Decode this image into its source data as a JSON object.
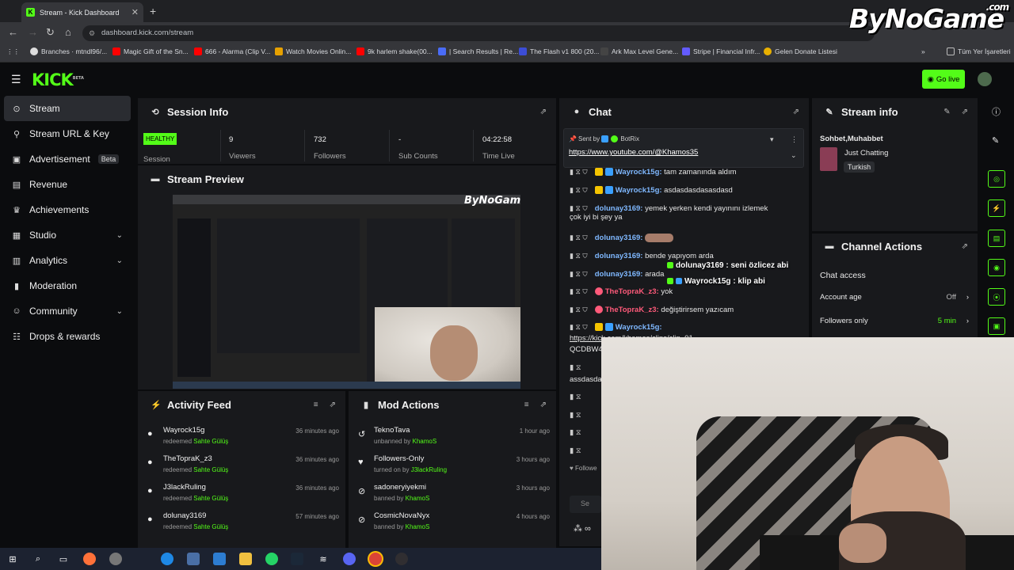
{
  "browser": {
    "tab_title": "Stream - Kick Dashboard",
    "tab_favicon": "K",
    "url": "dashboard.kick.com/stream",
    "bookmarks": [
      "Branches · mtndl96/...",
      "Magic Gift of the Sn...",
      "666 - Alarma (Clip V...",
      "Watch Movies Onlin...",
      "9k harlem shake(00...",
      "| Search Results | Re...",
      "The Flash v1 800 (20...",
      "Ark Max Level Gene...",
      "Stripe | Financial Infr...",
      "Gelen Donate Listesi"
    ],
    "all_bookmarks": "Tüm Yer İşaretleri"
  },
  "watermark": {
    "text": "ByNoGame",
    "suffix": ".com"
  },
  "header": {
    "logo": "KICK",
    "logo_sup": "BETA",
    "go_live": "Go live"
  },
  "sidebar": {
    "items": [
      {
        "label": "Stream",
        "icon": "broadcast-icon",
        "glyph": "((·))"
      },
      {
        "label": "Stream URL & Key",
        "icon": "link-icon",
        "glyph": "⚿"
      },
      {
        "label": "Advertisement",
        "icon": "ad-icon",
        "glyph": "▣",
        "badge": "Beta"
      },
      {
        "label": "Revenue",
        "icon": "revenue-icon",
        "glyph": "▤"
      },
      {
        "label": "Achievements",
        "icon": "trophy-icon",
        "glyph": "🏆"
      },
      {
        "label": "Studio",
        "icon": "studio-icon",
        "glyph": "▦"
      },
      {
        "label": "Analytics",
        "icon": "analytics-icon",
        "glyph": "▥"
      },
      {
        "label": "Moderation",
        "icon": "moderation-icon",
        "glyph": "⚑"
      },
      {
        "label": "Community",
        "icon": "community-icon",
        "glyph": "☺"
      },
      {
        "label": "Drops & rewards",
        "icon": "drops-icon",
        "glyph": "☷"
      }
    ]
  },
  "session": {
    "title": "Session Info",
    "status": "HEALTHY",
    "status_label": "Session",
    "viewers": "9",
    "viewers_label": "Viewers",
    "followers": "732",
    "followers_label": "Followers",
    "subs": "-",
    "subs_label": "Sub Counts",
    "time": "04:22:58",
    "time_label": "Time Live"
  },
  "preview": {
    "title": "Stream Preview",
    "wm": "ByNoGame"
  },
  "activity": {
    "title": "Activity Feed",
    "items": [
      {
        "user": "Wayrock15g",
        "action": "redeemed",
        "target": "Sahte Gülüş",
        "time": "36 minutes ago"
      },
      {
        "user": "TheTopraK_z3",
        "action": "redeemed",
        "target": "Sahte Gülüş",
        "time": "36 minutes ago"
      },
      {
        "user": "J3lackRuling",
        "action": "redeemed",
        "target": "Sahte Gülüş",
        "time": "36 minutes ago"
      },
      {
        "user": "dolunay3169",
        "action": "redeemed",
        "target": "Sahte Gülüş",
        "time": "57 minutes ago"
      }
    ]
  },
  "mod": {
    "title": "Mod Actions",
    "items": [
      {
        "user": "TeknoTava",
        "action": "unbanned by",
        "target": "KhamoS",
        "time": "1 hour ago",
        "icon": "unban-icon",
        "glyph": "↺"
      },
      {
        "user": "Followers-Only",
        "action": "turned on by",
        "target": "J3lackRuling",
        "time": "3 hours ago",
        "icon": "heart-icon",
        "glyph": "♥"
      },
      {
        "user": "sadoneryiyekmi",
        "action": "banned by",
        "target": "KhamoS",
        "time": "3 hours ago",
        "icon": "ban-icon",
        "glyph": "⊘"
      },
      {
        "user": "CosmicNovaNyx",
        "action": "banned by",
        "target": "KhamoS",
        "time": "4 hours ago",
        "icon": "ban-icon",
        "glyph": "⊘"
      }
    ]
  },
  "chat": {
    "title": "Chat",
    "pinned_by_label": "Sent by",
    "pinned_by": "BotRix",
    "pinned_link": "https://www.youtube.com/@Khamos35",
    "messages": [
      {
        "user": "Wayrock15g:",
        "text": "tam zamanında aldım",
        "color": "blue"
      },
      {
        "user": "Wayrock15g:",
        "text": "asdasdasdasasdasd",
        "color": "blue"
      },
      {
        "user": "dolunay3169:",
        "text": "yemek yerken kendi yayınını izlemek",
        "text2": "çok iyi bi şey ya",
        "color": "blue"
      },
      {
        "user": "dolunay3169:",
        "text": "",
        "color": "blue"
      },
      {
        "user": "dolunay3169:",
        "text": "bende yapıyom arda",
        "color": "blue"
      },
      {
        "user": "dolunay3169:",
        "text": "arada",
        "color": "blue"
      },
      {
        "user": "TheTopraK_z3:",
        "text": "yok",
        "color": "pink"
      },
      {
        "user": "TheTopraK_z3:",
        "text": "değiştirirsem yazıcam",
        "color": "pink"
      },
      {
        "user": "Wayrock15g:",
        "text": "",
        "color": "blue"
      }
    ],
    "partial_link": "https://kick.com/khamos/clips/clip_01...",
    "partial_link2": "QCDBW4",
    "partial_text": "assdasda",
    "followers_label": "Followe",
    "overlay1": "dolunay3169 : seni özlicez abi",
    "overlay2": "Wayrock15g : klip abi",
    "send_placeholder": "Se"
  },
  "stream_info": {
    "title": "Stream info",
    "stream_title": "Sohbet,Muhabbet",
    "category": "Just Chatting",
    "language": "Turkish"
  },
  "channel_actions": {
    "title": "Channel Actions",
    "section": "Chat access",
    "rows": [
      {
        "label": "Account age",
        "value": "Off"
      },
      {
        "label": "Followers only",
        "value": "5 min"
      }
    ]
  },
  "colors": {
    "accent": "#53fc18",
    "panel": "#18191c",
    "bg": "#0b0c0e"
  }
}
